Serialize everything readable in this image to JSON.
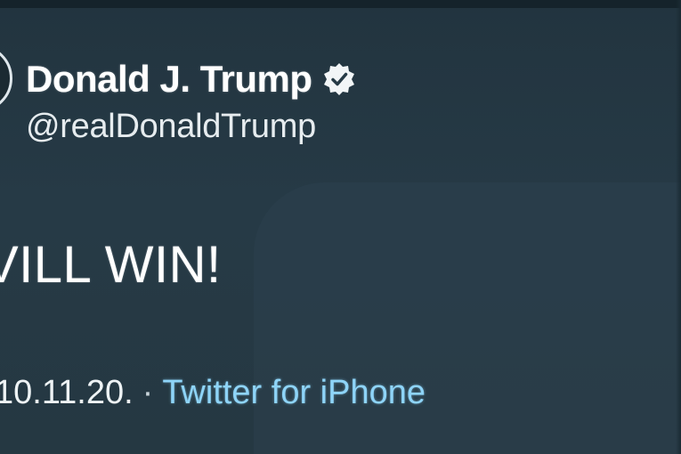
{
  "tweet": {
    "author": {
      "display_name": "Donald J. Trump",
      "handle": "@realDonaldTrump",
      "verified_icon": "verified-badge-icon"
    },
    "text": "VILL WIN!",
    "date": "10.11.20.",
    "separator": "·",
    "source": "Twitter for iPhone"
  },
  "colors": {
    "background": "#243541",
    "text": "#ffffff",
    "link": "#8ed4f8"
  }
}
